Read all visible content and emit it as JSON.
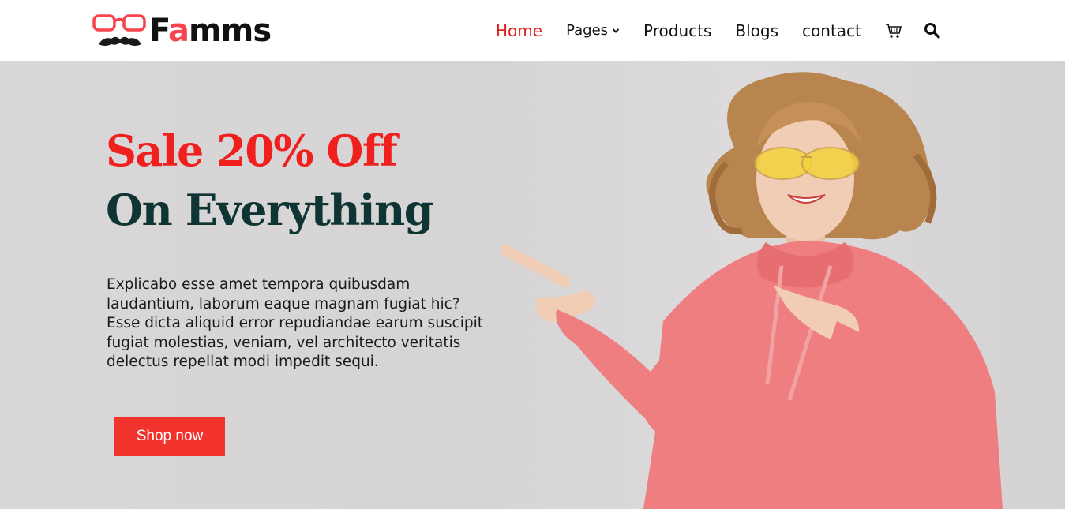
{
  "brand": {
    "name_prefix": "F",
    "name_accent": "a",
    "name_suffix": "mms",
    "accent_color": "#f7444e"
  },
  "nav": {
    "items": [
      {
        "label": "Home",
        "active": true
      },
      {
        "label": "Pages",
        "has_dropdown": true
      },
      {
        "label": "Products"
      },
      {
        "label": "Blogs"
      },
      {
        "label": "contact"
      }
    ],
    "icons": [
      "cart-icon",
      "search-icon"
    ]
  },
  "hero": {
    "headline_line1": "Sale 20% Off",
    "headline_line2": "On Everything",
    "body": "Explicabo esse amet tempora quibusdam laudantium, laborum eaque magnam fugiat hic? Esse dicta aliquid error repudiandae earum suscipit fugiat molestias, veniam, vel architecto veritatis delectus repellat modi impedit sequi.",
    "cta_label": "Shop now",
    "headline_color_1": "#f0201f",
    "headline_color_2": "#0f3434",
    "cta_color": "#f2322d"
  }
}
